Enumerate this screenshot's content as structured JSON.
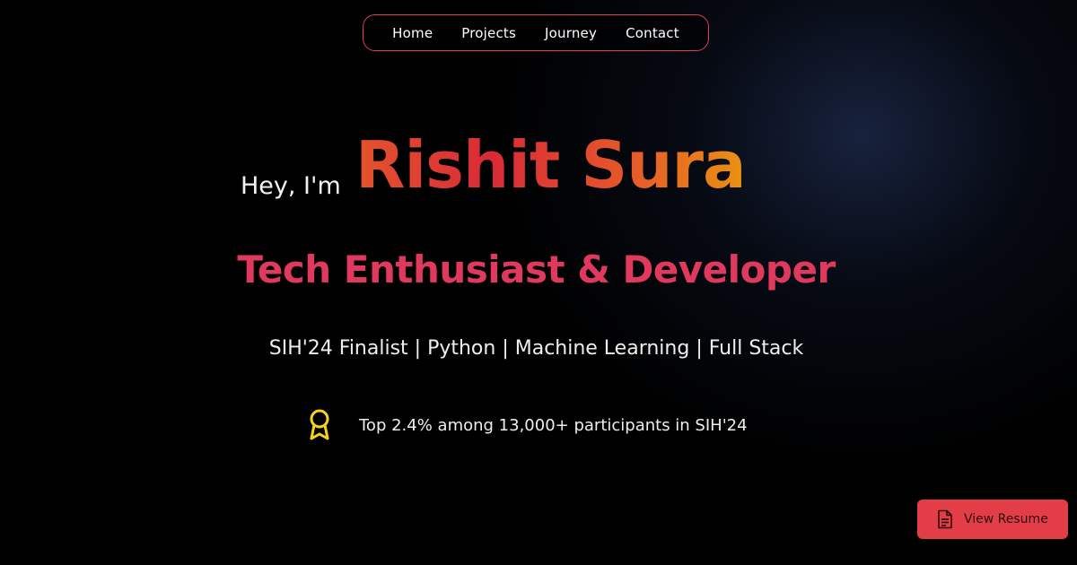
{
  "nav": {
    "items": [
      {
        "label": "Home"
      },
      {
        "label": "Projects"
      },
      {
        "label": "Journey"
      },
      {
        "label": "Contact"
      }
    ]
  },
  "hero": {
    "greeting": "Hey, I'm",
    "name": "Rishit Sura",
    "role": "Tech Enthusiast & Developer",
    "skills": "SIH'24 Finalist | Python | Machine Learning | Full Stack",
    "achievement": {
      "icon": "award-icon",
      "text": "Top 2.4% among 13,000+ participants in SIH'24"
    }
  },
  "resume_button": {
    "icon": "document-icon",
    "label": "View Resume"
  },
  "colors": {
    "accent": "#e0395e",
    "nav_border": "#d9415a",
    "button_bg": "#e33e48",
    "award_icon": "#f5d31a",
    "name_gradient": [
      "#e4542c",
      "#d92a37",
      "#ea9211"
    ]
  }
}
